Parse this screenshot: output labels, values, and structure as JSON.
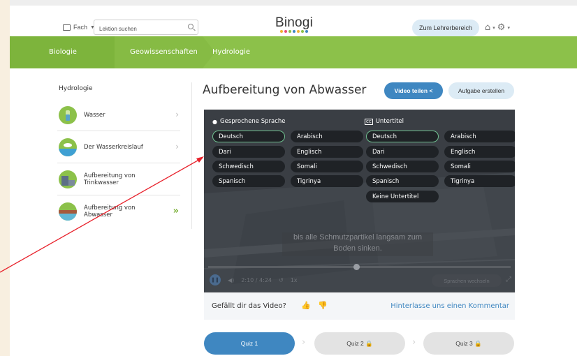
{
  "header": {
    "subject_menu_label": "Fach",
    "search_placeholder": "Lektion suchen",
    "logo_text": "Binogi",
    "logo_dot_colors": [
      "#f2b233",
      "#e94e77",
      "#8cc14a",
      "#3f87c1",
      "#f2b233",
      "#8cc14a",
      "#3f87c1"
    ],
    "teacher_button": "Zum Lehrerbereich",
    "icons": [
      "book-icon",
      "search-icon",
      "home-icon",
      "gear-icon"
    ]
  },
  "breadcrumbs": [
    "Biologie",
    "Geowissenschaften",
    "Hydrologie"
  ],
  "sidebar": {
    "title": "Hydrologie",
    "items": [
      {
        "label": "Wasser",
        "active": false
      },
      {
        "label": "Der Wasserkreislauf",
        "active": false
      },
      {
        "label": "Aufbereitung von Trinkwasser",
        "active": false
      },
      {
        "label": "Aufbereitung von Abwasser",
        "active": true
      }
    ]
  },
  "lesson": {
    "title": "Aufbereitung von Abwasser",
    "share_button": "Video teilen",
    "task_button": "Aufgabe erstellen"
  },
  "video": {
    "spoken_language_heading": "Gesprochene Sprache",
    "subtitles_heading": "Untertitel",
    "spoken_languages": [
      "Deutsch",
      "Arabisch",
      "Dari",
      "Englisch",
      "Schwedisch",
      "Somali",
      "Spanisch",
      "Tigrinya"
    ],
    "spoken_selected": "Deutsch",
    "subtitle_languages": [
      "Deutsch",
      "Arabisch",
      "Dari",
      "Englisch",
      "Schwedisch",
      "Somali",
      "Spanisch",
      "Tigrinya",
      "Keine Untertitel"
    ],
    "subtitle_selected": "Deutsch",
    "caption_line1": "bis alle Schmutzpartikel langsam zum",
    "caption_line2": "Boden sinken.",
    "time": "2:10 / 4:24",
    "speed": "1x",
    "progress_fraction": 0.49,
    "switch_language_button": "Sprachen wechseln"
  },
  "feedback": {
    "question": "Gefällt dir das Video?",
    "comment_link": "Hinterlasse uns einen Kommentar"
  },
  "quizzes": [
    {
      "label": "Quiz 1",
      "locked": false
    },
    {
      "label": "Quiz 2",
      "locked": true
    },
    {
      "label": "Quiz 3",
      "locked": true
    }
  ],
  "colors": {
    "green_bar": "#8cc14a",
    "accent_blue": "#3f87c1",
    "annotation_arrow": "#e8212b"
  }
}
